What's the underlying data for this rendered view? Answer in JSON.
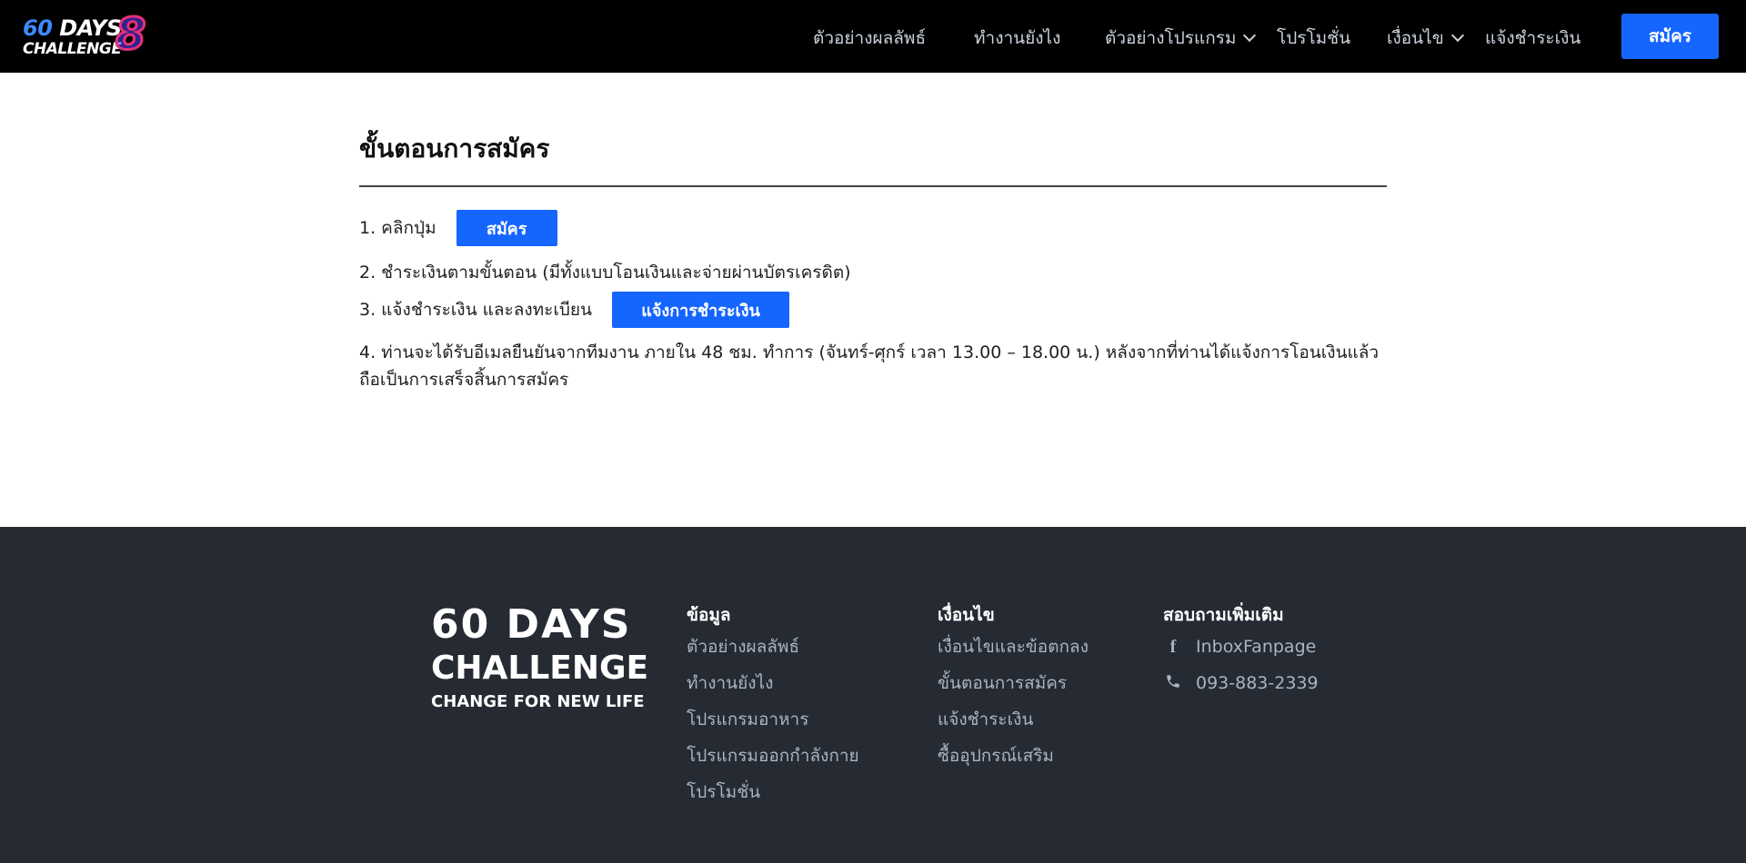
{
  "brand": {
    "logo_line1_a": "60",
    "logo_line1_b": "DAYS",
    "logo_line2": "CHALLENGE",
    "logo_number": "8",
    "accent_color": "#1565ff"
  },
  "nav": {
    "items": [
      {
        "label": "ตัวอย่างผลลัพธ์",
        "has_dropdown": false
      },
      {
        "label": "ทำงานยังไง",
        "has_dropdown": false
      },
      {
        "label": "ตัวอย่างโปรแกรม",
        "has_dropdown": true
      },
      {
        "label": "โปรโมชั่น",
        "has_dropdown": false
      },
      {
        "label": "เงื่อนไข",
        "has_dropdown": true
      },
      {
        "label": "แจ้งชำระเงิน",
        "has_dropdown": false
      }
    ],
    "signup_label": "สมัคร"
  },
  "main": {
    "title": "ขั้นตอนการสมัคร",
    "steps": [
      {
        "text": "1. คลิกปุ่ม",
        "button": "สมัคร"
      },
      {
        "text": "2. ชำระเงินตามขั้นตอน (มีทั้งแบบโอนเงินและจ่ายผ่านบัตรเครดิต)"
      },
      {
        "text": "3. แจ้งชำระเงิน และลงทะเบียน",
        "button": "แจ้งการชำระเงิน"
      },
      {
        "text": "4. ท่านจะได้รับอีเมลยืนยันจากทีมงาน ภายใน 48 ชม. ทำการ (จันทร์-ศุกร์ เวลา 13.00 – 18.00 น.) หลังจากที่ท่านได้แจ้งการโอนเงินแล้ว ถือเป็นการเสร็จสิ้นการสมัคร"
      }
    ]
  },
  "footer": {
    "logo_l1": "60 DAYS",
    "logo_l2": "CHALLENGE",
    "logo_l3": "CHANGE FOR NEW LIFE",
    "col1": {
      "title": "ข้อมูล",
      "links": [
        "ตัวอย่างผลลัพธ์",
        "ทำงานยังไง",
        "โปรแกรมอาหาร",
        "โปรแกรมออกกำลังกาย",
        "โปรโมชั่น"
      ]
    },
    "col2": {
      "title": "เงื่อนไข",
      "links": [
        "เงื่อนไขและข้อตกลง",
        "ขั้นตอนการสมัคร",
        "แจ้งชำระเงิน",
        "ซื้ออุปกรณ์เสริม"
      ]
    },
    "col3": {
      "title": "สอบถามเพิ่มเติม",
      "facebook_icon": "facebook-icon",
      "facebook": "InboxFanpage",
      "phone_icon": "phone-icon",
      "phone": "093-883-2339"
    }
  }
}
